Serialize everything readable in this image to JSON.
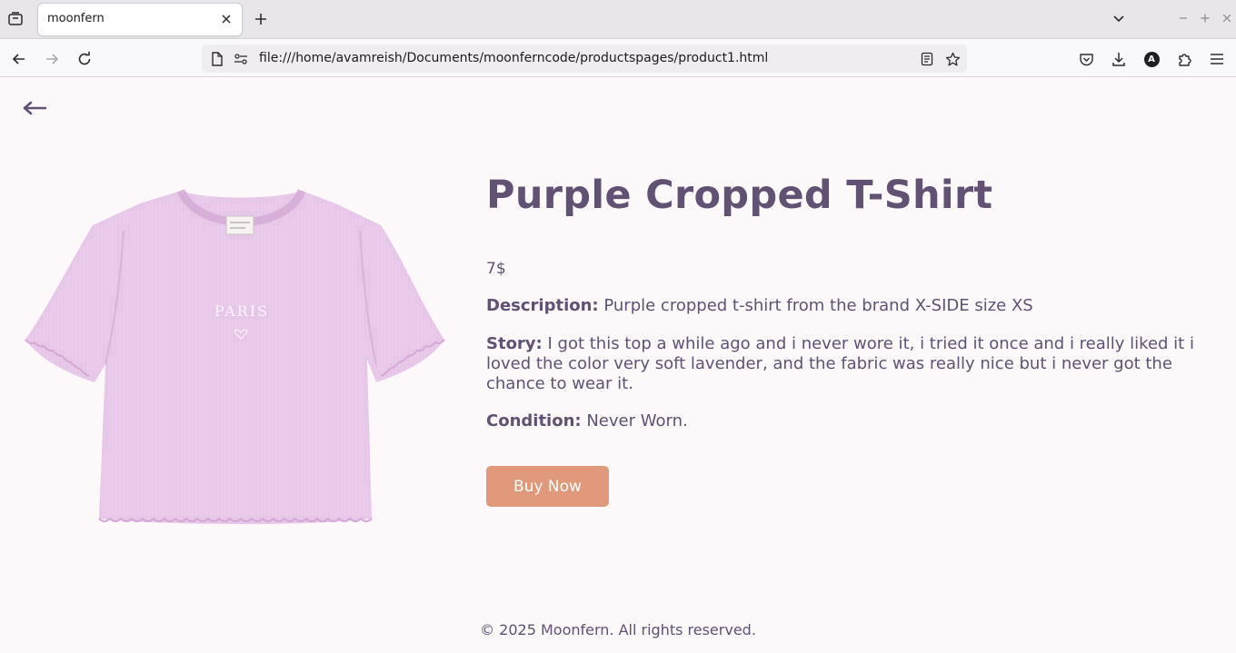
{
  "browser": {
    "tab": {
      "title": "moonfern"
    },
    "url": "file:///home/avamreish/Documents/moonferncode/productspages/product1.html",
    "profile_initial": "A",
    "icons": [
      "tab-list-icon",
      "close-icon",
      "plus-icon",
      "chevron-down-icon",
      "minimize-icon",
      "maximize-icon",
      "window-close-icon",
      "back-icon",
      "forward-icon",
      "reload-icon",
      "page-icon",
      "permissions-icon",
      "reader-view-icon",
      "bookmark-star-icon",
      "pocket-icon",
      "download-icon",
      "account-icon",
      "extensions-icon",
      "menu-icon"
    ]
  },
  "product": {
    "title": "Purple Cropped T-Shirt",
    "price": "7$",
    "description_label": "Description:",
    "description": "Purple cropped t-shirt from the brand X-SIDE size XS",
    "story_label": "Story:",
    "story": "I got this top a while ago and i never wore it, i tried it once and i really liked it i loved the color very soft lavender, and the fabric was really nice but i never got the chance to wear it.",
    "condition_label": "Condition:",
    "condition": "Never Worn.",
    "buy_label": "Buy Now",
    "image_print_text": "PARIS",
    "shirt_color": "#e9c9ea"
  },
  "back_label": "←",
  "footer": {
    "text": "© 2025 Moonfern. All rights reserved."
  },
  "colors": {
    "text": "#615172",
    "button": "#e09a7b",
    "background": "#fdf9fb"
  }
}
